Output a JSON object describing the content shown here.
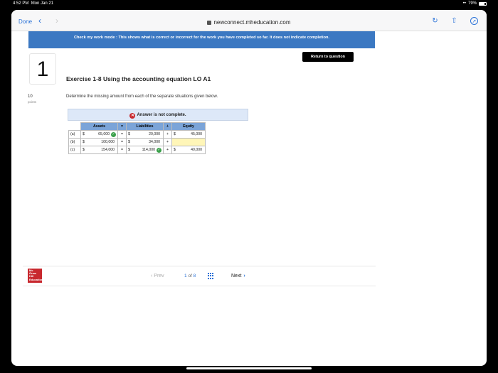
{
  "status": {
    "time": "4:52 PM",
    "date": "Mon Jan 21",
    "battery": "79%"
  },
  "browser": {
    "done_label": "Done",
    "back_icon": "chevron-left-icon",
    "forward_icon": "chevron-right-icon",
    "url": "newconnect.mheducation.com"
  },
  "banner": {
    "text": "Check my work mode : This shows what is correct or incorrect for the work you have completed so far. It does not indicate completion."
  },
  "return_button": "Return to question",
  "question": {
    "number": "1",
    "points_value": "10",
    "points_label": "points"
  },
  "exercise": {
    "title": "Exercise 1-8 Using the accounting equation LO A1",
    "description": "Determine the missing amount from each of the separate situations given below."
  },
  "answer_status": "Answer is not complete.",
  "table": {
    "headers": {
      "assets": "Assets",
      "eq": "=",
      "liabilities": "Liabilities",
      "plus": "+",
      "equity": "Equity"
    },
    "rows": [
      {
        "label": "(a)",
        "assets_cur": "$",
        "assets": "65,000",
        "assets_correct": true,
        "eq": "=",
        "liab_cur": "$",
        "liabilities": "20,000",
        "liab_correct": false,
        "plus": "+",
        "equity_cur": "$",
        "equity": "45,000",
        "equity_input": false
      },
      {
        "label": "(b)",
        "assets_cur": "$",
        "assets": "100,000",
        "assets_correct": false,
        "eq": "=",
        "liab_cur": "$",
        "liabilities": "34,000",
        "liab_correct": false,
        "plus": "+",
        "equity_cur": "",
        "equity": "",
        "equity_input": true
      },
      {
        "label": "(c)",
        "assets_cur": "$",
        "assets": "154,000",
        "assets_correct": false,
        "eq": "=",
        "liab_cur": "$",
        "liabilities": "114,000",
        "liab_correct": true,
        "plus": "+",
        "equity_cur": "$",
        "equity": "40,000",
        "equity_input": false
      }
    ]
  },
  "pagination": {
    "prev": "Prev",
    "current": "1",
    "of": "of",
    "total": "8",
    "next": "Next"
  },
  "logo": {
    "text": "Mc Graw Hill Education"
  },
  "colors": {
    "banner": "#3b78c2",
    "accent": "#2a72d8",
    "header_cell": "#7ba4d8",
    "error": "#c8282e",
    "correct": "#3aa04a",
    "input_highlight": "#fff6b8"
  }
}
